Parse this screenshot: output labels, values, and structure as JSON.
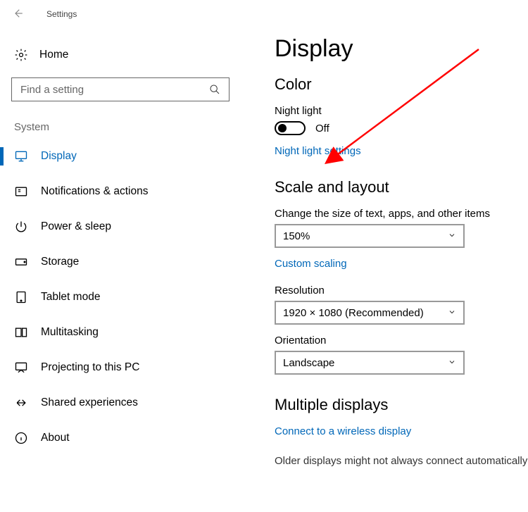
{
  "app": {
    "title": "Settings"
  },
  "sidebar": {
    "home_label": "Home",
    "search_placeholder": "Find a setting",
    "section_label": "System",
    "items": [
      {
        "label": "Display"
      },
      {
        "label": "Notifications & actions"
      },
      {
        "label": "Power & sleep"
      },
      {
        "label": "Storage"
      },
      {
        "label": "Tablet mode"
      },
      {
        "label": "Multitasking"
      },
      {
        "label": "Projecting to this PC"
      },
      {
        "label": "Shared experiences"
      },
      {
        "label": "About"
      }
    ]
  },
  "main": {
    "page_title": "Display",
    "color_heading": "Color",
    "night_light_label": "Night light",
    "night_light_state": "Off",
    "night_light_settings_link": "Night light settings",
    "scale_heading": "Scale and layout",
    "scale_label": "Change the size of text, apps, and other items",
    "scale_value": "150%",
    "custom_scaling_link": "Custom scaling",
    "resolution_label": "Resolution",
    "resolution_value": "1920 × 1080 (Recommended)",
    "orientation_label": "Orientation",
    "orientation_value": "Landscape",
    "multiple_displays_heading": "Multiple displays",
    "connect_wireless_link": "Connect to a wireless display",
    "cut_text": "Older displays might not always connect automatically"
  }
}
